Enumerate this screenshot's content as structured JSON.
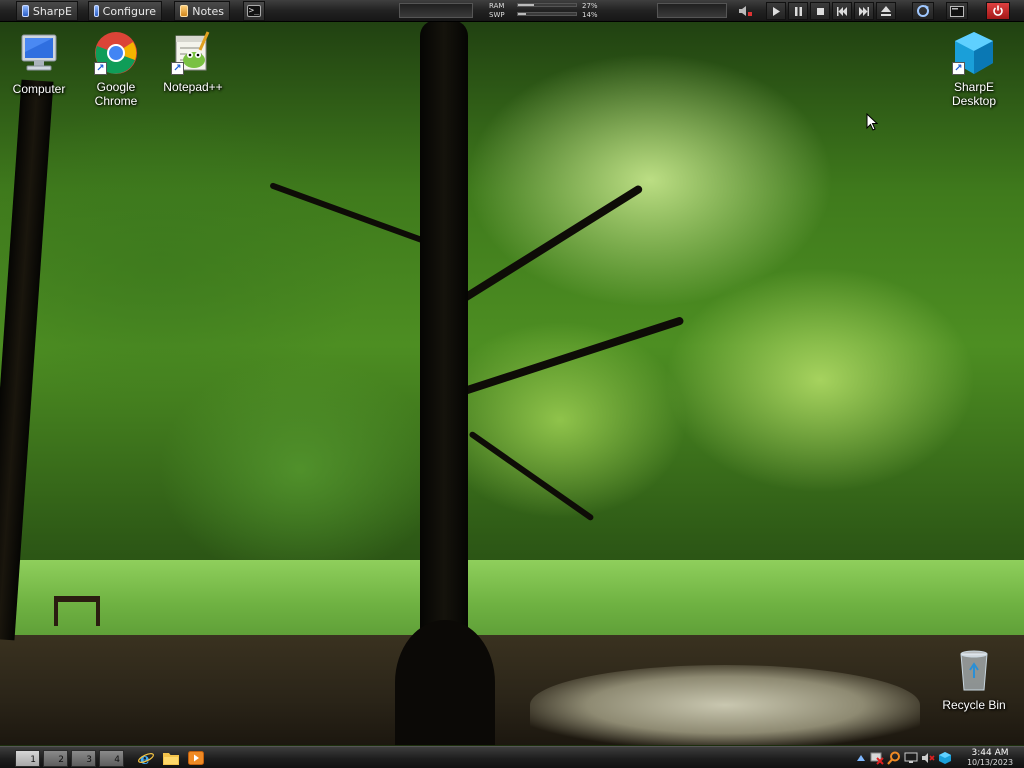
{
  "topbar": {
    "buttons": [
      {
        "label": "SharpE",
        "icon": "computer-icon"
      },
      {
        "label": "Configure",
        "icon": "computer-icon"
      },
      {
        "label": "Notes",
        "icon": "notes-icon"
      }
    ],
    "terminal_icon": "terminal-icon",
    "meters": {
      "ram": {
        "label": "RAM",
        "value": "27%",
        "fraction": 0.27
      },
      "swap": {
        "label": "SWP",
        "value": "14%",
        "fraction": 0.14
      }
    },
    "media": {
      "mute_icon": "speaker-muted-icon",
      "controls": [
        "play-icon",
        "pause-icon",
        "stop-icon",
        "previous-icon",
        "next-icon",
        "eject-icon"
      ]
    },
    "right_icons": [
      "refresh-icon",
      "terminal-icon",
      "power-icon"
    ],
    "colors": {
      "power": "#d52a2a",
      "bar": "#222222"
    }
  },
  "desktop": {
    "icons": [
      {
        "label": "Computer",
        "icon": "computer-icon",
        "shortcut": false
      },
      {
        "label": "Google\nChrome",
        "icon": "chrome-icon",
        "shortcut": true
      },
      {
        "label": "Notepad++",
        "icon": "notepad-plus-plus-icon",
        "shortcut": true
      },
      {
        "label": "SharpE\nDesktop",
        "icon": "cube-icon",
        "shortcut": true
      },
      {
        "label": "Recycle Bin",
        "icon": "recycle-bin-icon",
        "shortcut": false
      }
    ]
  },
  "taskbar": {
    "virtual_desktops": [
      "1",
      "2",
      "3",
      "4"
    ],
    "active_desktop": "1",
    "quicklaunch": [
      "internet-explorer-icon",
      "folder-icon",
      "media-player-icon"
    ],
    "tray_icons": [
      "arrow-up-icon",
      "network-disconnected-icon",
      "search-icon",
      "monitor-icon",
      "speaker-muted-icon",
      "sharpe-icon"
    ],
    "clock": {
      "time": "3:44 AM",
      "date": "10/13/2023"
    }
  }
}
